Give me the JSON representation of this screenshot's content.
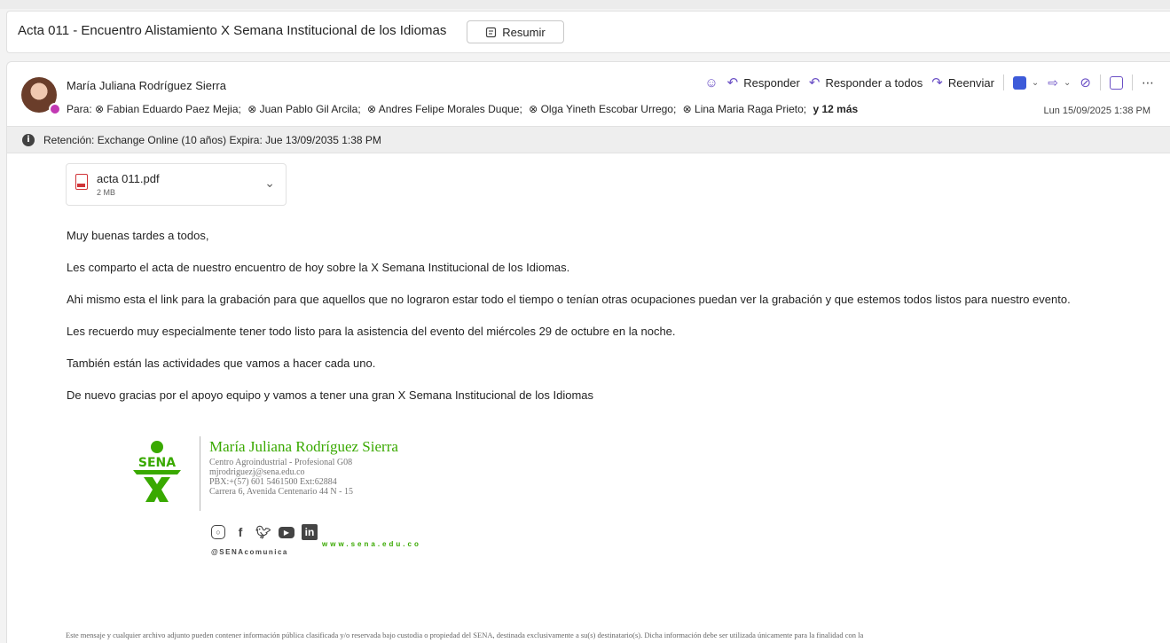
{
  "subject": {
    "title": "Acta 011 - Encuentro Alistamiento X Semana Institucional de los Idiomas",
    "summarize_label": "Resumir"
  },
  "message": {
    "sender": "María Juliana Rodríguez Sierra",
    "to_label": "Para:",
    "recipients": [
      "Fabian Eduardo Paez Mejia;",
      "Juan Pablo Gil Arcila;",
      "Andres Felipe Morales Duque;",
      "Olga Yineth Escobar Urrego;",
      "Lina Maria Raga Prieto;"
    ],
    "more_recipients": "y 12 más",
    "date": "Lun 15/09/2025 1:38 PM",
    "actions": {
      "reply": "Responder",
      "reply_all": "Responder a todos",
      "forward": "Reenviar"
    }
  },
  "retention": {
    "text": "Retención: Exchange Online (10 años) Expira: Jue 13/09/2035 1:38 PM"
  },
  "attachment": {
    "name": "acta 011.pdf",
    "size": "2 MB"
  },
  "body": {
    "greeting": "Muy buenas tardes a todos,",
    "p1": "Les comparto el acta de nuestro encuentro de hoy sobre la X Semana Institucional de los Idiomas.",
    "p2": "Ahi mismo esta el link para la grabación para que aquellos que no lograron estar todo el tiempo o tenían otras ocupaciones puedan ver la grabación y que estemos todos listos para nuestro evento.",
    "p3": "Les recuerdo muy especialmente tener todo listo para la asistencia del evento del miércoles 29 de octubre en la noche.",
    "p4": "También están las actividades que vamos a hacer cada uno.",
    "p5": "De nuevo gracias por el apoyo equipo y vamos a tener una gran X Semana Institucional de los Idiomas"
  },
  "signature": {
    "logo_text": "SENA",
    "name": "María Juliana Rodríguez Sierra",
    "line1": "Centro Agroindustrial - Profesional G08",
    "line2": "mjrodriguezj@sena.edu.co",
    "line3": "PBX:+(57) 601 5461500 Ext:62884",
    "line4": "Carrera 6, Avenida Centenario 44 N - 15",
    "website": "www.sena.edu.co",
    "handle": "@SENAcomunica"
  },
  "disclaimer": "Este mensaje y cualquier archivo adjunto pueden contener información pública clasificada y/o reservada bajo custodia o propiedad del SENA, destinada exclusivamente a su(s) destinatario(s). Dicha información debe ser utilizada únicamente para la finalidad con la",
  "colors": {
    "accent": "#6a4fc5",
    "sena_green": "#39a900",
    "pdf_red": "#d13438"
  }
}
